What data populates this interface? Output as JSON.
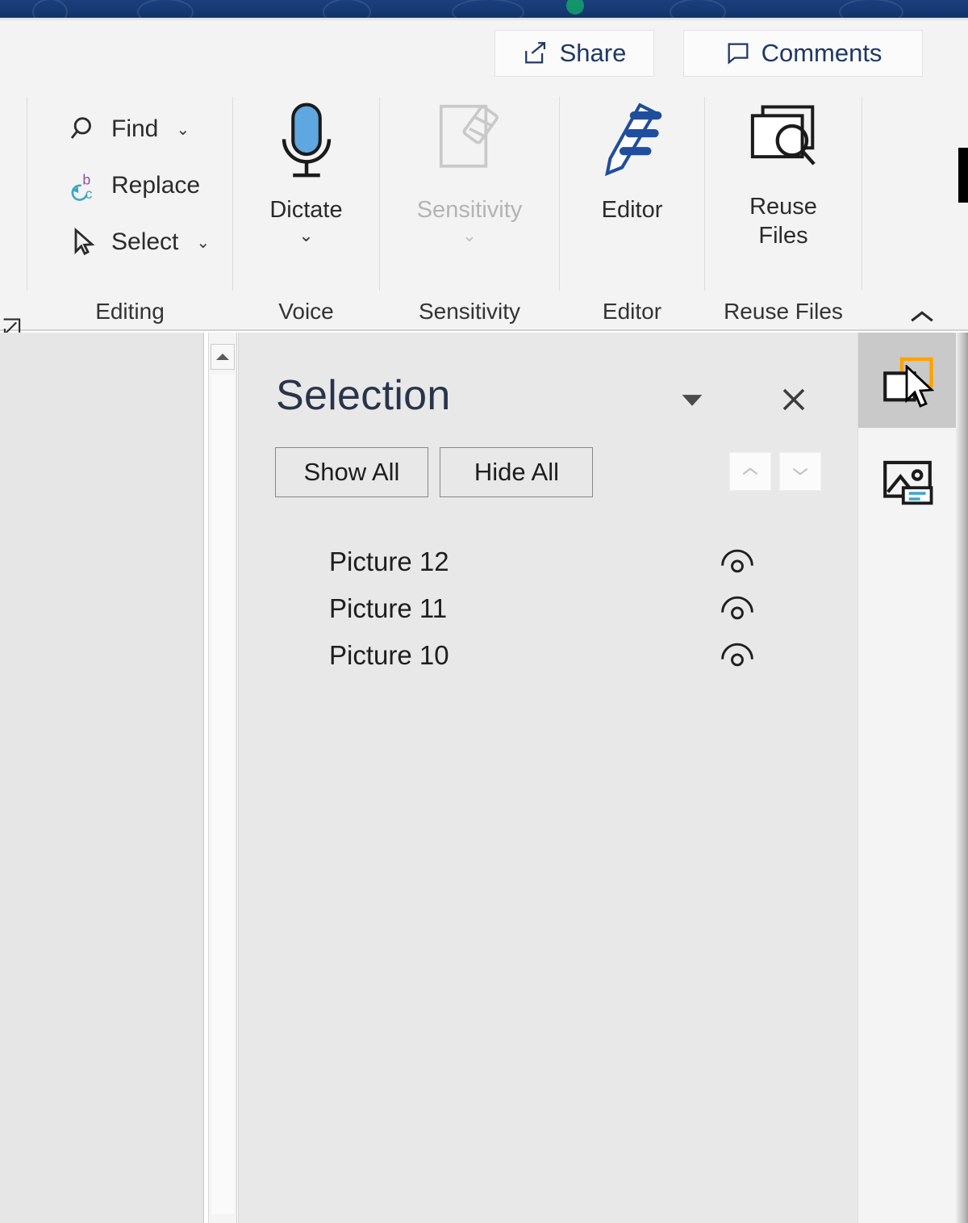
{
  "titlebar": {
    "present": true
  },
  "ribbon": {
    "share_label": "Share",
    "comments_label": "Comments",
    "collapse_icon": "chevron-up-icon",
    "dialog_launcher_icon": "dialog-launcher-icon",
    "groups": [
      {
        "id": "editing",
        "label": "Editing",
        "items": [
          {
            "id": "find",
            "label": "Find",
            "icon": "magnifier-icon",
            "has_caret": true,
            "disabled": false
          },
          {
            "id": "replace",
            "label": "Replace",
            "icon": "replace-bc-icon",
            "has_caret": false,
            "disabled": false
          },
          {
            "id": "select",
            "label": "Select",
            "icon": "pointer-arrow-icon",
            "has_caret": true,
            "disabled": false
          }
        ]
      },
      {
        "id": "voice",
        "label": "Voice",
        "items": [
          {
            "id": "dictate",
            "label": "Dictate",
            "icon": "microphone-icon",
            "has_caret": true,
            "disabled": false
          }
        ]
      },
      {
        "id": "sensitivity",
        "label": "Sensitivity",
        "items": [
          {
            "id": "sensitivity",
            "label": "Sensitivity",
            "icon": "sensitivity-label-icon",
            "has_caret": true,
            "disabled": true
          }
        ]
      },
      {
        "id": "editor",
        "label": "Editor",
        "items": [
          {
            "id": "editor",
            "label": "Editor",
            "icon": "editor-pen-icon",
            "has_caret": false,
            "disabled": false
          }
        ]
      },
      {
        "id": "reuse-files",
        "label": "Reuse Files",
        "items": [
          {
            "id": "reuse-files",
            "label": "Reuse\nFiles",
            "label_line1": "Reuse",
            "label_line2": "Files",
            "icon": "reuse-files-icon",
            "has_caret": false,
            "disabled": false
          }
        ]
      }
    ]
  },
  "selection_pane": {
    "title": "Selection",
    "menu_icon": "caret-down-icon",
    "close_icon": "close-x-icon",
    "show_all_label": "Show All",
    "hide_all_label": "Hide All",
    "move_up_icon": "chevron-up-icon",
    "move_down_icon": "chevron-down-icon",
    "objects": [
      {
        "name": "Picture 12",
        "visible": true,
        "eye_icon": "eye-visible-icon"
      },
      {
        "name": "Picture 11",
        "visible": true,
        "eye_icon": "eye-visible-icon"
      },
      {
        "name": "Picture 10",
        "visible": true,
        "eye_icon": "eye-visible-icon"
      }
    ]
  },
  "right_rail": {
    "buttons": [
      {
        "id": "selection-pane",
        "icon": "selection-pane-icon",
        "active": true
      },
      {
        "id": "alt-text",
        "icon": "picture-alt-text-icon",
        "active": false
      }
    ]
  },
  "scrollbar": {
    "up_icon": "scroll-up-icon"
  },
  "colors": {
    "titlebar": "#163a74",
    "ribbon_bg": "#f3f3f3",
    "pane_bg": "#e8e8e8",
    "doc_bg": "#e6e6e6",
    "accent_blue": "#2b579a",
    "title_text": "#28344a",
    "rail_active": "#c9c9c9",
    "orange": "#ffa300"
  }
}
